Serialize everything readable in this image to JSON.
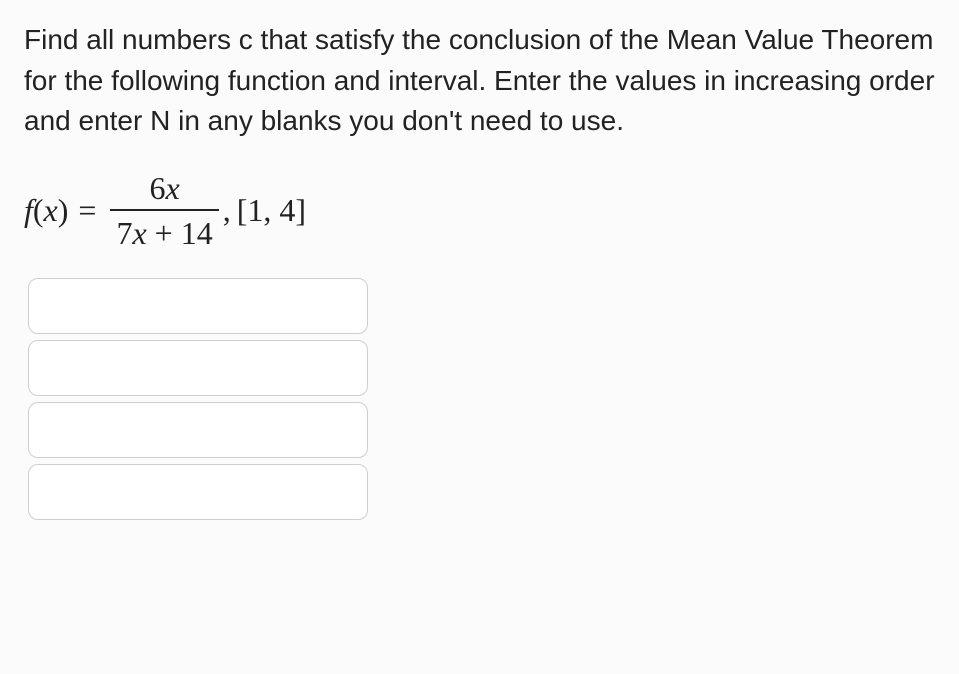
{
  "problem": {
    "text": "Find all numbers c that satisfy the conclusion of the Mean Value Theorem for the following function and interval. Enter the values in increasing order and enter N in any blanks you don't need to use."
  },
  "formula": {
    "lhs_f": "f",
    "lhs_paren_open": "(",
    "lhs_x": "x",
    "lhs_paren_close": ")",
    "equals": "=",
    "numerator_coeff": "6",
    "numerator_var": "x",
    "denominator_coeff": "7",
    "denominator_var": "x",
    "denominator_plus": " + ",
    "denominator_const": "14",
    "comma": ", ",
    "interval": "[1, 4]"
  },
  "inputs": {
    "count": 4
  }
}
